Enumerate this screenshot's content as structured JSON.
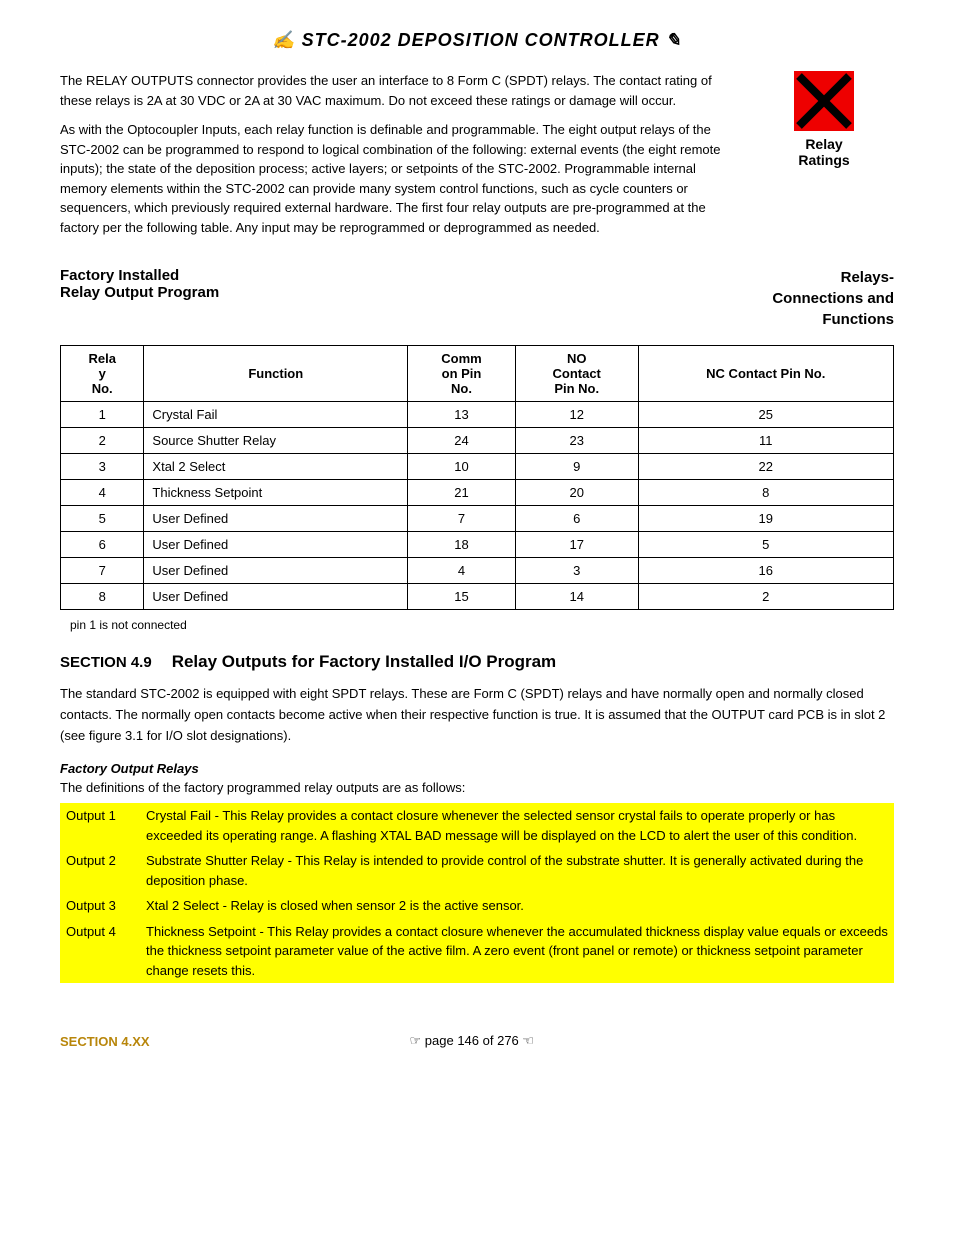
{
  "page": {
    "title": "✍ STC-2002  DEPOSITION CONTROLLER ✎",
    "intro_para1": "The RELAY OUTPUTS connector provides the user an interface to 8 Form C (SPDT) relays.  The contact rating of these relays is 2A at 30 VDC or 2A at 30 VAC maximum.  Do not exceed these ratings or damage will occur.",
    "intro_para2": "As with the Optocoupler Inputs, each relay function is definable and programmable.  The eight output relays of the STC-2002 can be programmed to respond to logical combination of the following: external events (the eight remote inputs); the state of the deposition process; active layers; or setpoints of the STC-2002.  Programmable internal memory elements within the STC-2002 can provide many system control functions, such as cycle counters or sequencers, which previously required external hardware.  The first four relay outputs are pre-programmed at the factory per the following table.  Any input may be reprogrammed or deprogrammed as needed.",
    "relay_label_line1": "Relay",
    "relay_label_line2": "Ratings"
  },
  "factory_section": {
    "heading_line1": "Factory Installed",
    "heading_line2": "Relay Output Program",
    "right_heading": "Relays-\nConnections and\nFunctions"
  },
  "table": {
    "headers": [
      "Rela y No.",
      "Function",
      "Comm on Pin No.",
      "NO Contact Pin No.",
      "NC Contact Pin No."
    ],
    "rows": [
      {
        "relay": "1",
        "function": "Crystal Fail",
        "comm": "13",
        "no": "12",
        "nc": "25"
      },
      {
        "relay": "2",
        "function": "Source Shutter Relay",
        "comm": "24",
        "no": "23",
        "nc": "11"
      },
      {
        "relay": "3",
        "function": "Xtal 2 Select",
        "comm": "10",
        "no": "9",
        "nc": "22"
      },
      {
        "relay": "4",
        "function": "Thickness Setpoint",
        "comm": "21",
        "no": "20",
        "nc": "8"
      },
      {
        "relay": "5",
        "function": "User Defined",
        "comm": "7",
        "no": "6",
        "nc": "19"
      },
      {
        "relay": "6",
        "function": "User Defined",
        "comm": "18",
        "no": "17",
        "nc": "5"
      },
      {
        "relay": "7",
        "function": "User Defined",
        "comm": "4",
        "no": "3",
        "nc": "16"
      },
      {
        "relay": "8",
        "function": "User Defined",
        "comm": "15",
        "no": "14",
        "nc": "2"
      }
    ],
    "pin_note": "pin 1 is not connected"
  },
  "section49": {
    "number": "SECTION 4.9",
    "title": "Relay Outputs for Factory Installed I/O Program",
    "body1": "The standard STC-2002 is equipped with eight SPDT relays.  These are Form C (SPDT) relays and have normally open and normally closed contacts.  The normally open contacts become active when their respective function is true.  It is assumed that the OUTPUT card PCB is in slot 2 (see figure 3.1 for I/O slot designations).",
    "factory_output_heading": "Factory Output Relays",
    "factory_output_intro": "The definitions of the factory programmed relay outputs are as follows:",
    "outputs": [
      {
        "label": "Output 1",
        "desc": "Crystal Fail - This Relay provides a contact closure whenever the selected sensor crystal fails to operate properly or has exceeded its operating range.  A flashing XTAL BAD message will be displayed on the LCD to alert the user of this condition."
      },
      {
        "label": "Output 2",
        "desc": "Substrate Shutter Relay - This Relay is intended to provide control of the substrate shutter. It is generally activated during the deposition phase."
      },
      {
        "label": "Output 3",
        "desc": "Xtal 2 Select - Relay is closed when sensor 2 is the active sensor."
      },
      {
        "label": "Output 4",
        "desc": "Thickness Setpoint - This Relay provides a contact closure whenever the accumulated thickness display value equals or exceeds the thickness setpoint parameter value of the active film.  A zero event (front panel or remote) or thickness setpoint parameter change resets this."
      }
    ]
  },
  "footer": {
    "section_label": "SECTION 4.XX",
    "page_text": "☞  page 146 of 276  ☜"
  }
}
